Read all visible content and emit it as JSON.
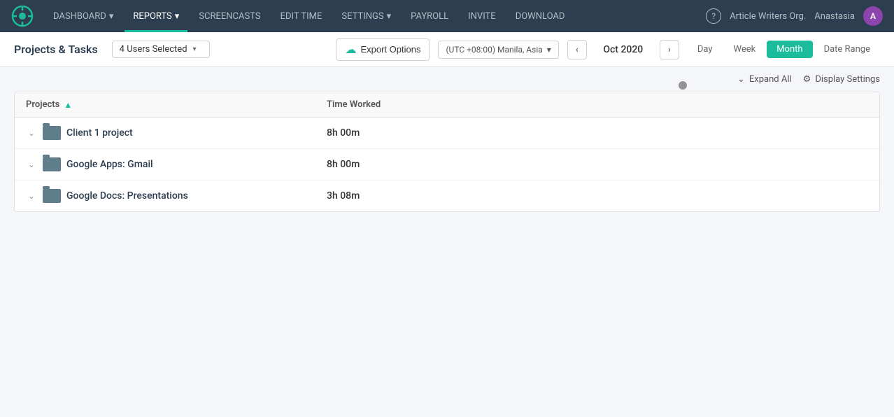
{
  "nav": {
    "logo_alt": "Hub Staff Logo",
    "items": [
      {
        "label": "DASHBOARD",
        "has_dropdown": true,
        "active": false
      },
      {
        "label": "REPORTS",
        "has_dropdown": true,
        "active": true
      },
      {
        "label": "SCREENCASTS",
        "has_dropdown": false,
        "active": false
      },
      {
        "label": "EDIT TIME",
        "has_dropdown": false,
        "active": false
      },
      {
        "label": "SETTINGS",
        "has_dropdown": true,
        "active": false
      },
      {
        "label": "PAYROLL",
        "has_dropdown": false,
        "active": false
      },
      {
        "label": "INVITE",
        "has_dropdown": false,
        "active": false
      },
      {
        "label": "DOWNLOAD",
        "has_dropdown": false,
        "active": false
      }
    ],
    "help_label": "?",
    "org_name": "Article Writers Org.",
    "user_name": "Anastasia",
    "avatar_letter": "A"
  },
  "subheader": {
    "page_title": "Projects & Tasks",
    "users_selected": "4 Users Selected",
    "export_label": "Export Options",
    "timezone": "(UTC +08:00) Manila, Asia",
    "current_date": "Oct 2020",
    "view_tabs": [
      {
        "label": "Day",
        "active": false
      },
      {
        "label": "Week",
        "active": false
      },
      {
        "label": "Month",
        "active": true
      },
      {
        "label": "Date Range",
        "active": false
      }
    ]
  },
  "toolbar": {
    "expand_all": "Expand All",
    "display_settings": "Display Settings"
  },
  "table": {
    "col_projects": "Projects",
    "col_time": "Time Worked",
    "rows": [
      {
        "name": "Client 1 project",
        "time": "8h 00m"
      },
      {
        "name": "Google Apps: Gmail",
        "time": "8h 00m"
      },
      {
        "name": "Google Docs: Presentations",
        "time": "3h 08m"
      }
    ]
  }
}
